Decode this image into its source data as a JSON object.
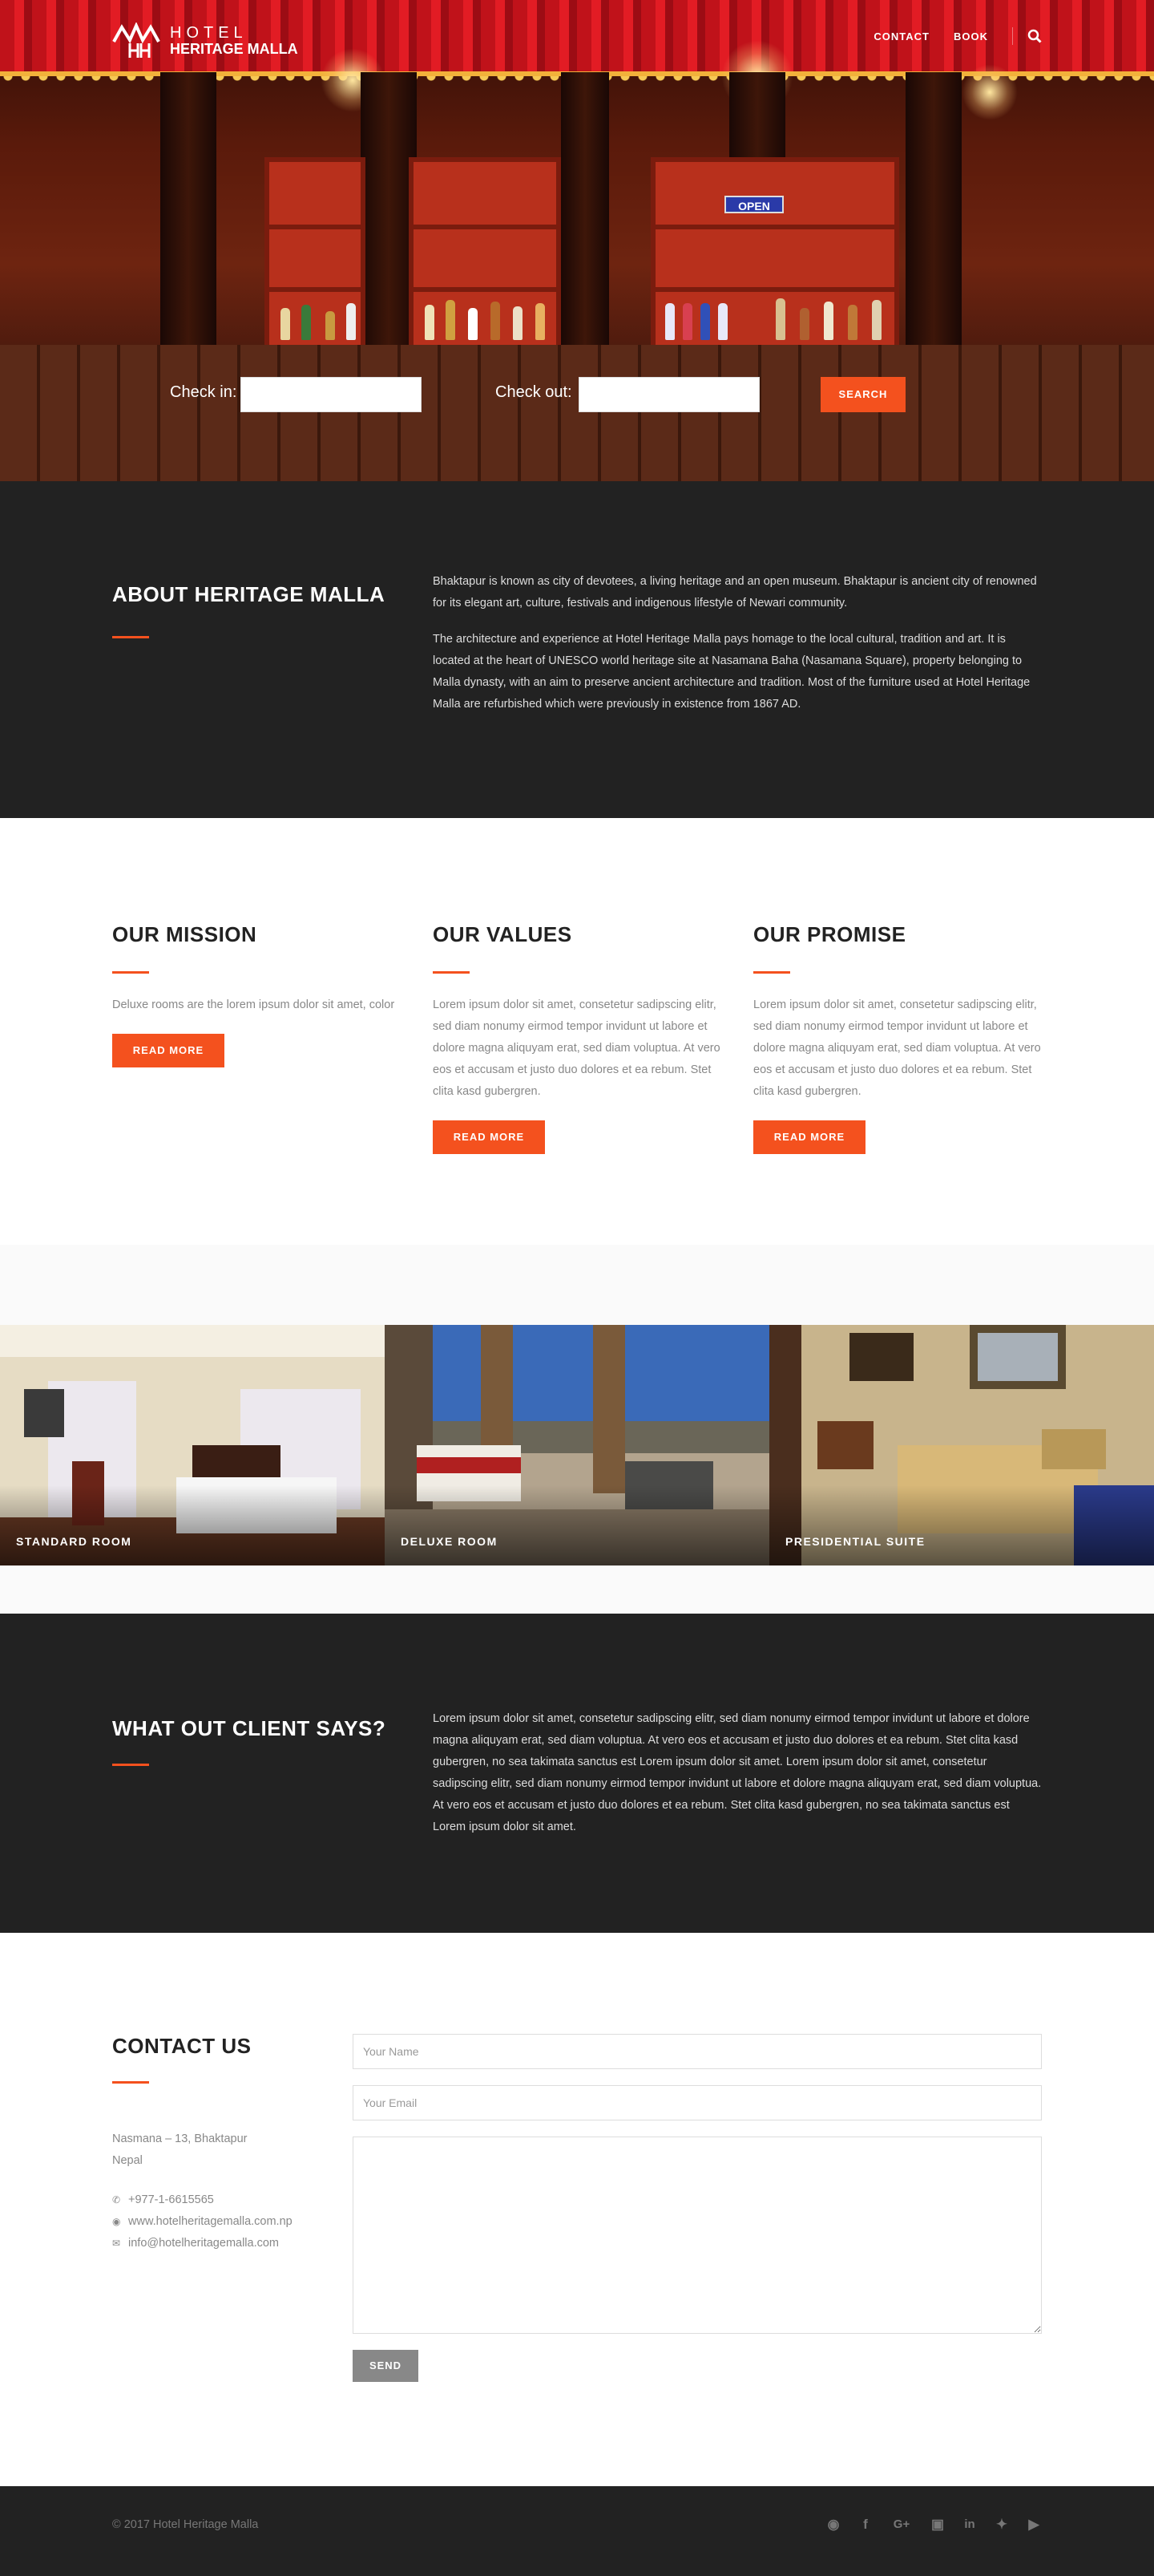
{
  "nav": {
    "logo_line1": "HOTEL",
    "logo_line2": "HERITAGE MALLA",
    "links": [
      "CONTACT",
      "BOOK"
    ],
    "search_icon": "search-icon"
  },
  "hero": {
    "sign_text": "OPEN",
    "checkin_label": "Check in:",
    "checkout_label": "Check out:",
    "search_label": "SEARCH"
  },
  "about": {
    "title": "ABOUT HERITAGE MALLA",
    "para1": "Bhaktapur is known as city of devotees, a living heritage and an open museum. Bhaktapur is ancient city of renowned for its elegant art, culture, festivals and indigenous lifestyle of Newari community.",
    "para2": "The architecture and experience at Hotel Heritage Malla pays homage to the local cultural, tradition and art. It is located at the heart of UNESCO world heritage site at Nasamana Baha (Nasamana Square), property belonging to Malla dynasty, with an aim to preserve ancient architecture and tradition.  Most of the furniture used at Hotel Heritage Malla are refurbished which were previously in existence from 1867 AD."
  },
  "features": [
    {
      "title": "OUR MISSION",
      "text": "Deluxe rooms are the lorem ipsum dolor sit amet, color",
      "button": "READ MORE"
    },
    {
      "title": "OUR VALUES",
      "text": "Lorem ipsum dolor sit amet, consetetur sadipscing elitr, sed diam nonumy eirmod tempor invidunt ut labore et dolore magna aliquyam erat, sed diam voluptua. At vero eos et accusam et justo duo dolores et ea rebum. Stet clita kasd gubergren.",
      "button": "READ MORE"
    },
    {
      "title": "OUR PROMISE",
      "text": "Lorem ipsum dolor sit amet, consetetur sadipscing elitr, sed diam nonumy eirmod tempor invidunt ut labore et dolore magna aliquyam erat, sed diam voluptua. At vero eos et accusam et justo duo dolores et ea rebum. Stet clita kasd gubergren.",
      "button": "READ MORE"
    }
  ],
  "rooms": [
    "STANDARD ROOM",
    "DELUXE ROOM",
    "PRESIDENTIAL SUITE"
  ],
  "testimonial": {
    "title": "WHAT OUT CLIENT SAYS?",
    "text": "Lorem ipsum dolor sit amet, consetetur sadipscing elitr, sed diam nonumy eirmod tempor invidunt ut labore et dolore magna aliquyam erat, sed diam voluptua. At vero eos et accusam et justo duo dolores et ea rebum. Stet clita kasd gubergren, no sea takimata sanctus est Lorem ipsum dolor sit amet. Lorem ipsum dolor sit amet, consetetur sadipscing elitr, sed diam nonumy eirmod tempor invidunt ut labore et dolore magna aliquyam erat, sed diam voluptua. At vero eos et accusam et justo duo dolores et ea rebum. Stet clita kasd gubergren, no sea takimata sanctus est Lorem ipsum dolor sit amet."
  },
  "contact": {
    "title": "CONTACT US",
    "address_line1": "Nasmana – 13, Bhaktapur",
    "address_line2": "Nepal",
    "phone": "+977-1-6615565",
    "website": "www.hotelheritagemalla.com.np",
    "email": "info@hotelheritagemalla.com",
    "name_placeholder": "Your Name",
    "email_placeholder": "Your Email",
    "send_label": "SEND"
  },
  "footer": {
    "copyright": "© 2017 Hotel Heritage Malla",
    "socials": [
      "dribbble-icon",
      "facebook-icon",
      "google-plus-icon",
      "instagram-icon",
      "linkedin-icon",
      "twitter-icon",
      "youtube-icon"
    ]
  },
  "colors": {
    "accent": "#f4511e",
    "dark": "#222222",
    "send": "#888888"
  }
}
